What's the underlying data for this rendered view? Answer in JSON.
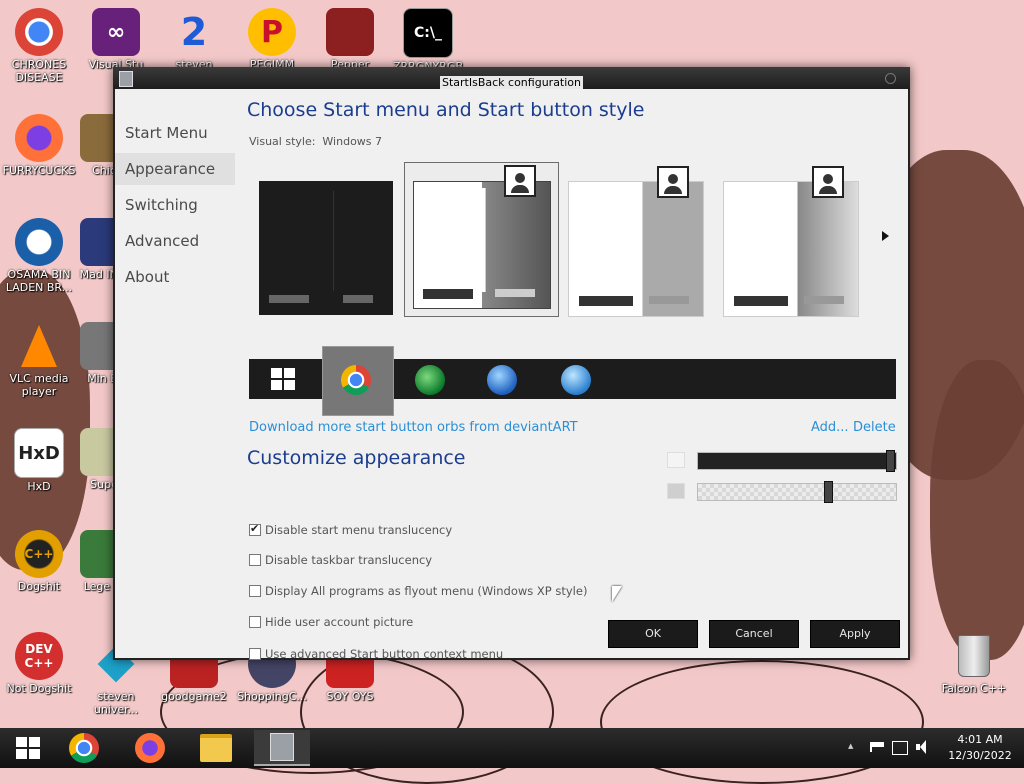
{
  "desktop": {
    "left_column": [
      {
        "label": "CHRONES DISEASE"
      },
      {
        "label": "FURRYCUCKS"
      },
      {
        "label": "OSAMA BIN LADEN BR..."
      },
      {
        "label": "VLC media player"
      },
      {
        "label": "HxD"
      },
      {
        "label": "Dogshit"
      },
      {
        "label": "Not Dogshit"
      }
    ],
    "second_column": [
      {
        "label": "Visual Stu"
      },
      {
        "label": "Chic"
      },
      {
        "label": "Mad IN S"
      },
      {
        "label": "Min Bl"
      },
      {
        "label": "Supe"
      },
      {
        "label": "Lege Zi"
      },
      {
        "label": "steven univer..."
      }
    ],
    "top_row": [
      {
        "label": "steven"
      },
      {
        "label": "PEGIMM WIFFI"
      },
      {
        "label": "Pepper"
      },
      {
        "label": "ZRRGNYRGB"
      }
    ],
    "bottom_row": [
      {
        "label": "goodgame2"
      },
      {
        "label": "ShoppingC..."
      },
      {
        "label": "SOY OYS"
      }
    ],
    "recycle_bin": {
      "label": "Falcon C++"
    }
  },
  "window": {
    "title": "StartIsBack configuration",
    "nav": [
      "Start Menu",
      "Appearance",
      "Switching",
      "Advanced",
      "About"
    ],
    "active_nav": "Appearance",
    "heading_style": "Choose Start menu and Start button style",
    "visual_style_label": "Visual style:",
    "visual_style_value": "Windows 7",
    "download_link": "Download more start button orbs from deviantART",
    "add_link": "Add...",
    "delete_link": "Delete",
    "heading_customize": "Customize appearance",
    "options": [
      {
        "label": "Disable start menu translucency",
        "checked": true
      },
      {
        "label": "Disable taskbar translucency",
        "checked": false
      },
      {
        "label": "Display All programs as flyout menu (Windows XP style)",
        "checked": false
      },
      {
        "label": "Hide user account picture",
        "checked": false
      },
      {
        "label": "Use advanced Start button context menu",
        "checked": false
      }
    ],
    "start_menu_opacity_fraction": 1.0,
    "taskbar_opacity_fraction": 0.65,
    "buttons": {
      "ok": "OK",
      "cancel": "Cancel",
      "apply": "Apply"
    }
  },
  "taskbar": {
    "time": "4:01 AM",
    "date": "12/30/2022",
    "tray_up_arrow": "▲"
  }
}
